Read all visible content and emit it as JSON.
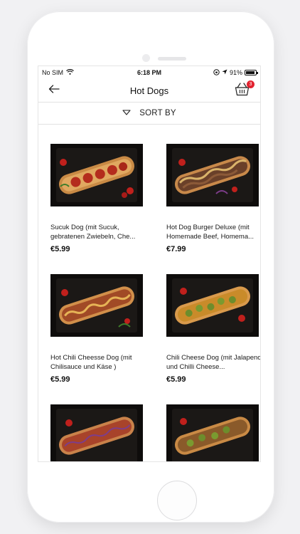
{
  "status_bar": {
    "carrier": "No SIM",
    "time": "6:18 PM",
    "battery_text": "91%",
    "battery_level": 0.91,
    "icons": [
      "wifi-icon",
      "orientation-lock-icon",
      "location-arrow-icon",
      "battery-icon"
    ]
  },
  "nav": {
    "title": "Hot Dogs",
    "back_icon": "arrow-left-icon",
    "cart_icon": "shopping-basket-icon",
    "cart_count": "3"
  },
  "sort": {
    "label": "SORT BY",
    "icon": "triangle-down-icon"
  },
  "products": [
    {
      "name": "Sucuk Dog (mit Sucuk, gebratenen Zwiebeln, Che...",
      "price": "€5.99"
    },
    {
      "name": "Hot Dog Burger Deluxe (mit Homemade Beef, Homema...",
      "price": "€7.99"
    },
    {
      "name": "Hot Chili Cheesse Dog (mit Chilisauce und Käse )",
      "price": "€5.99"
    },
    {
      "name": "Chili Cheese Dog (mit Jalapenos und Chilli Cheese...",
      "price": "€5.99"
    },
    {
      "name": "",
      "price": ""
    },
    {
      "name": "",
      "price": ""
    }
  ],
  "colors": {
    "accent": "#e2222f",
    "image_background": "#0e0c0b"
  }
}
